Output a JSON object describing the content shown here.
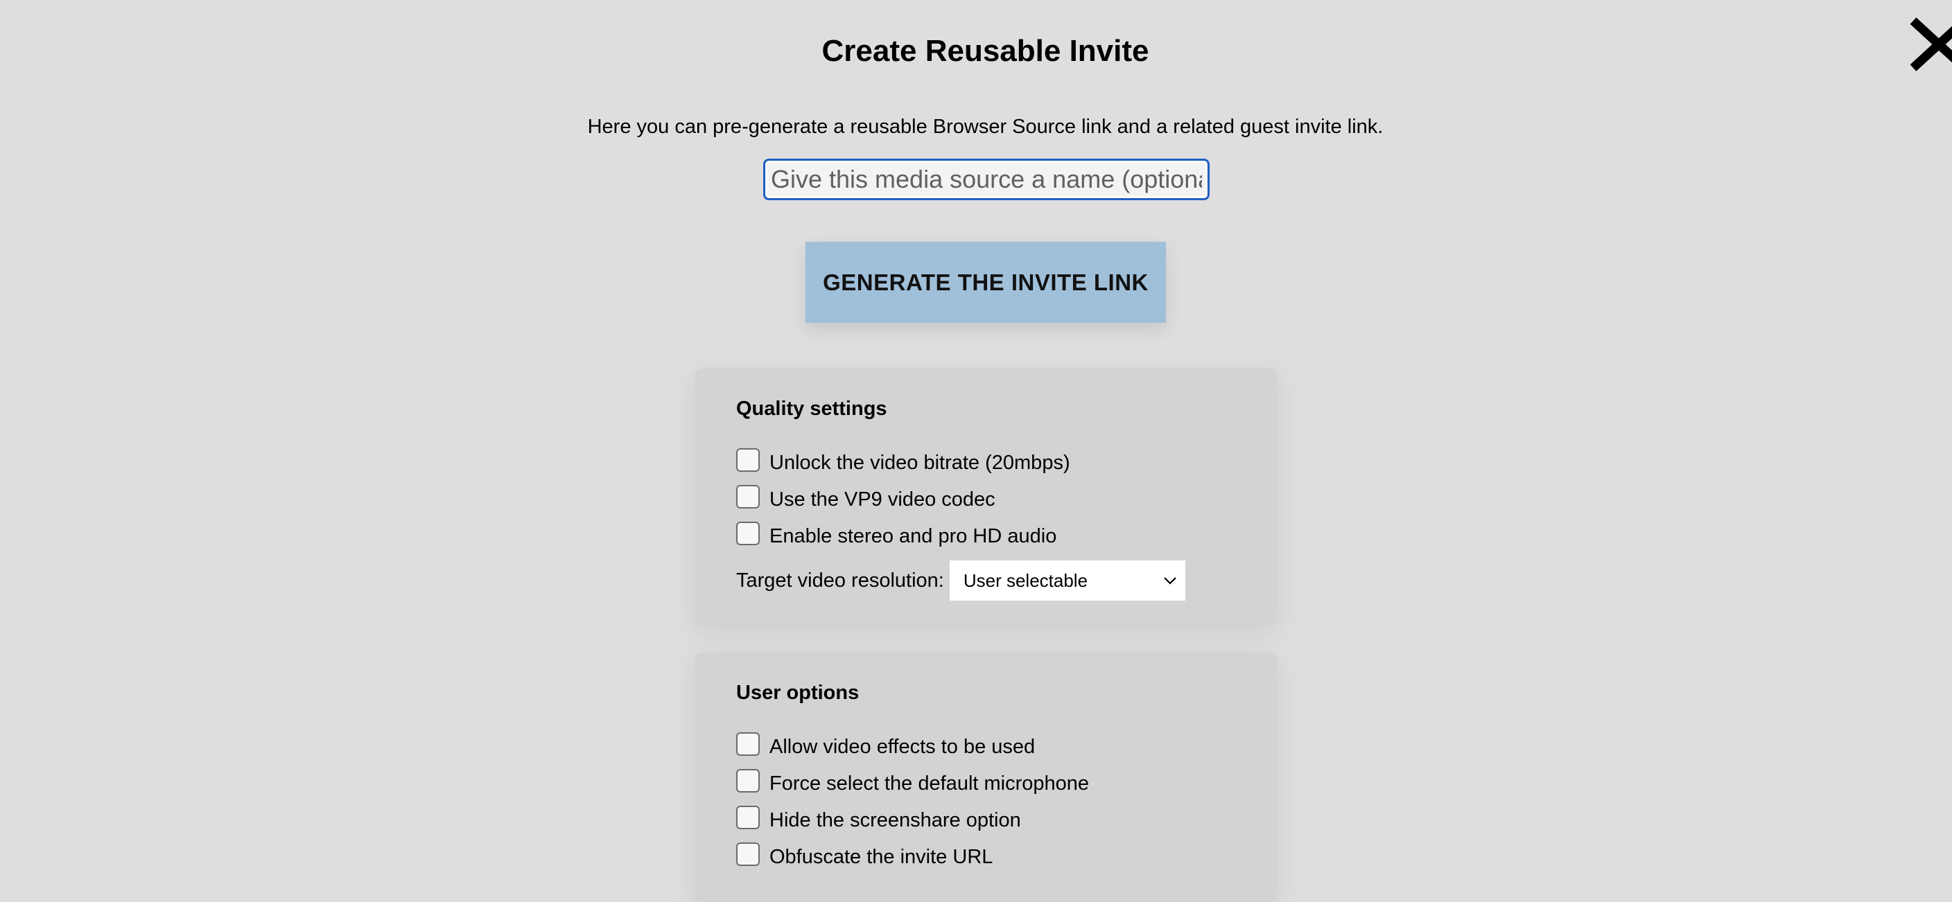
{
  "dialog": {
    "title": "Create Reusable Invite",
    "intro": "Here you can pre-generate a reusable Browser Source link and a related guest invite link.",
    "name_input": {
      "placeholder": "Give this media source a name (optional)",
      "value": ""
    },
    "generate_button": "GENERATE THE INVITE LINK",
    "close_icon": "close-icon"
  },
  "quality_settings": {
    "heading": "Quality settings",
    "options": [
      {
        "label": "Unlock the video bitrate (20mbps)",
        "checked": false
      },
      {
        "label": "Use the VP9 video codec",
        "checked": false
      },
      {
        "label": "Enable stereo and pro HD audio",
        "checked": false
      }
    ],
    "resolution": {
      "label": "Target video resolution:",
      "selected": "User selectable"
    }
  },
  "user_options": {
    "heading": "User options",
    "options": [
      {
        "label": "Allow video effects to be used",
        "checked": false
      },
      {
        "label": "Force select the default microphone",
        "checked": false
      },
      {
        "label": "Hide the screenshare option",
        "checked": false
      },
      {
        "label": "Obfuscate the invite URL",
        "checked": false
      }
    ]
  },
  "colors": {
    "background": "#dedede",
    "panel": "#d3d3d3",
    "button": "#a0bfd9",
    "focus_ring": "#1f5fc4"
  }
}
